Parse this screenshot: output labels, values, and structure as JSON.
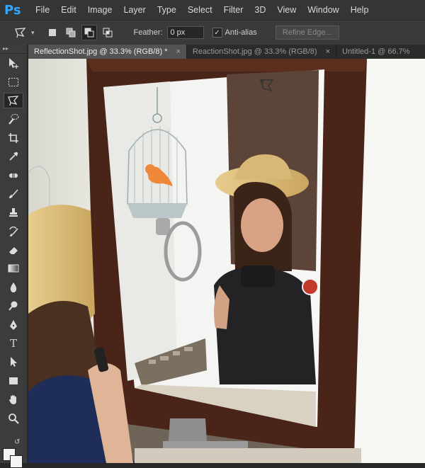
{
  "app": {
    "logo": "Ps"
  },
  "menu": [
    "File",
    "Edit",
    "Image",
    "Layer",
    "Type",
    "Select",
    "Filter",
    "3D",
    "View",
    "Window",
    "Help"
  ],
  "options": {
    "feather_label": "Feather:",
    "feather_value": "0 px",
    "antialias_label": "Anti-alias",
    "antialias_checked": true,
    "refine_edge_label": "Refine Edge..."
  },
  "tabs": [
    {
      "label": "ReflectionShot.jpg @ 33.3% (RGB/8) *",
      "active": true
    },
    {
      "label": "ReactionShot.jpg @ 33.3% (RGB/8)",
      "active": false
    },
    {
      "label": "Untitled-1 @ 66.7%",
      "active": false
    }
  ],
  "tools": [
    "move-tool",
    "marquee-tool",
    "polygonal-lasso-tool",
    "quick-selection-tool",
    "crop-tool",
    "eyedropper-tool",
    "spot-healing-tool",
    "brush-tool",
    "clone-stamp-tool",
    "history-brush-tool",
    "eraser-tool",
    "gradient-tool",
    "blur-tool",
    "dodge-tool",
    "pen-tool",
    "type-tool",
    "path-selection-tool",
    "rectangle-tool",
    "hand-tool",
    "zoom-tool"
  ],
  "type_tool_glyph": "T",
  "colors": {
    "accent": "#31a8ff",
    "mirror_frame": "#4a2418",
    "bird": "#f0883a"
  }
}
